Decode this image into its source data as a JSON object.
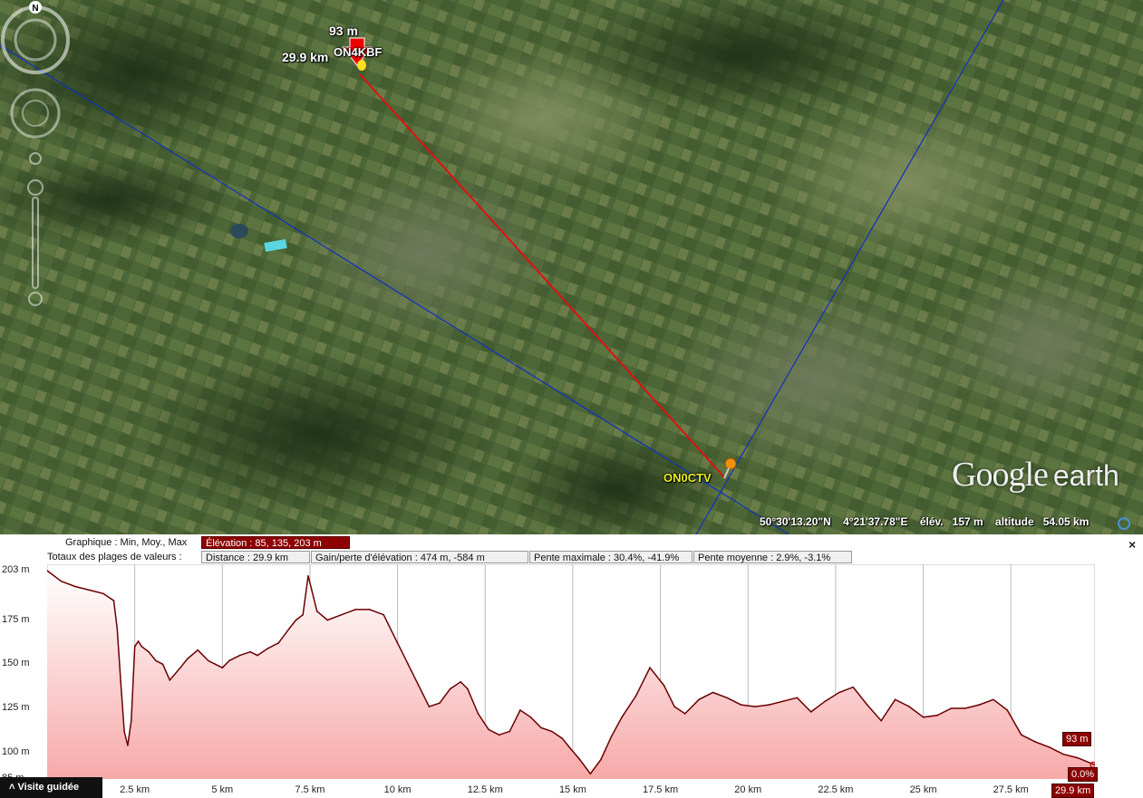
{
  "map": {
    "placemark_start": "ON4KBF",
    "placemark_end": "ON0CTV",
    "cursor_elevation": "93 m",
    "cursor_distance": "29.9 km",
    "logo_google": "Google",
    "logo_earth": "earth",
    "compass_north": "N",
    "status": {
      "lat": "50°30'13.20\"N",
      "lon": "4°21'37.78\"E",
      "elev_label": "élév.",
      "elev_value": "157 m",
      "alt_label": "altitude",
      "alt_value": "54.05 km"
    },
    "colors": {
      "path_line": "#e01010",
      "grid_lines": "#1030c0"
    }
  },
  "profile": {
    "row1_label": "Graphique : Min, Moy., Max",
    "row1_elevation": "Élévation : 85, 135, 203 m",
    "row2_label": "Totaux des plages de valeurs :",
    "row2_distance": "Distance : 29.9 km",
    "row2_gain": "Gain/perte d'élévation : 474 m, -584 m",
    "row2_slope_max": "Pente maximale : 30.4%, -41.9%",
    "row2_slope_avg": "Pente moyenne : 2.9%, -3.1%",
    "close": "×",
    "tour_label": "Visite guidée",
    "cursor_elev_tag": "93 m",
    "cursor_slope_tag": "0.0%",
    "cursor_dist_tag": "29.9 km"
  },
  "chart_data": {
    "type": "area",
    "title": "",
    "xlabel": "",
    "ylabel": "",
    "ylim": [
      85,
      203
    ],
    "xlim": [
      0,
      29.9
    ],
    "y_ticks": [
      "203 m",
      "175 m",
      "150 m",
      "125 m",
      "100 m",
      "85 m"
    ],
    "x_ticks": [
      "2.5 km",
      "5 km",
      "7.5 km",
      "10 km",
      "12.5 km",
      "15 km",
      "17.5 km",
      "20 km",
      "22.5 km",
      "25 km",
      "27.5 km"
    ],
    "x_tick_values": [
      2.5,
      5,
      7.5,
      10,
      12.5,
      15,
      17.5,
      20,
      22.5,
      25,
      27.5
    ],
    "y_tick_values": [
      203,
      175,
      150,
      125,
      100,
      85
    ],
    "series": [
      {
        "x": [
          0,
          0.4,
          0.8,
          1.2,
          1.6,
          1.9,
          2.0,
          2.1,
          2.2,
          2.3,
          2.4,
          2.5,
          2.6,
          2.7,
          2.9,
          3.1,
          3.3,
          3.5,
          3.8,
          4.0,
          4.3,
          4.6,
          4.8,
          5.0,
          5.2,
          5.5,
          5.8,
          6.0,
          6.3,
          6.6,
          6.9,
          7.1,
          7.3,
          7.45,
          7.55,
          7.7,
          8.0,
          8.4,
          8.8,
          9.2,
          9.6,
          10.0,
          10.3,
          10.6,
          10.9,
          11.2,
          11.5,
          11.8,
          12.0,
          12.3,
          12.6,
          12.9,
          13.2,
          13.5,
          13.8,
          14.1,
          14.4,
          14.7,
          14.9,
          15.2,
          15.5,
          15.8,
          16.1,
          16.4,
          16.8,
          17.2,
          17.6,
          17.9,
          18.2,
          18.6,
          19.0,
          19.4,
          19.8,
          20.2,
          20.6,
          21.0,
          21.4,
          21.8,
          22.2,
          22.6,
          23.0,
          23.4,
          23.8,
          24.2,
          24.6,
          25.0,
          25.4,
          25.8,
          26.2,
          26.6,
          27.0,
          27.4,
          27.8,
          28.2,
          28.6,
          29.0,
          29.4,
          29.9
        ],
        "y": [
          203,
          197,
          194,
          192,
          190,
          186,
          170,
          140,
          112,
          104,
          118,
          160,
          163,
          160,
          157,
          152,
          150,
          141,
          148,
          153,
          158,
          152,
          150,
          148,
          152,
          155,
          157,
          155,
          159,
          162,
          170,
          175,
          178,
          200,
          192,
          180,
          175,
          178,
          181,
          181,
          178,
          162,
          150,
          138,
          126,
          128,
          136,
          140,
          136,
          122,
          113,
          110,
          112,
          124,
          120,
          114,
          112,
          108,
          103,
          96,
          88,
          96,
          109,
          120,
          132,
          148,
          138,
          126,
          122,
          130,
          134,
          131,
          127,
          126,
          127,
          129,
          131,
          123,
          129,
          134,
          137,
          127,
          118,
          130,
          126,
          120,
          121,
          125,
          125,
          127,
          130,
          124,
          110,
          106,
          103,
          99,
          97,
          93
        ]
      }
    ]
  }
}
